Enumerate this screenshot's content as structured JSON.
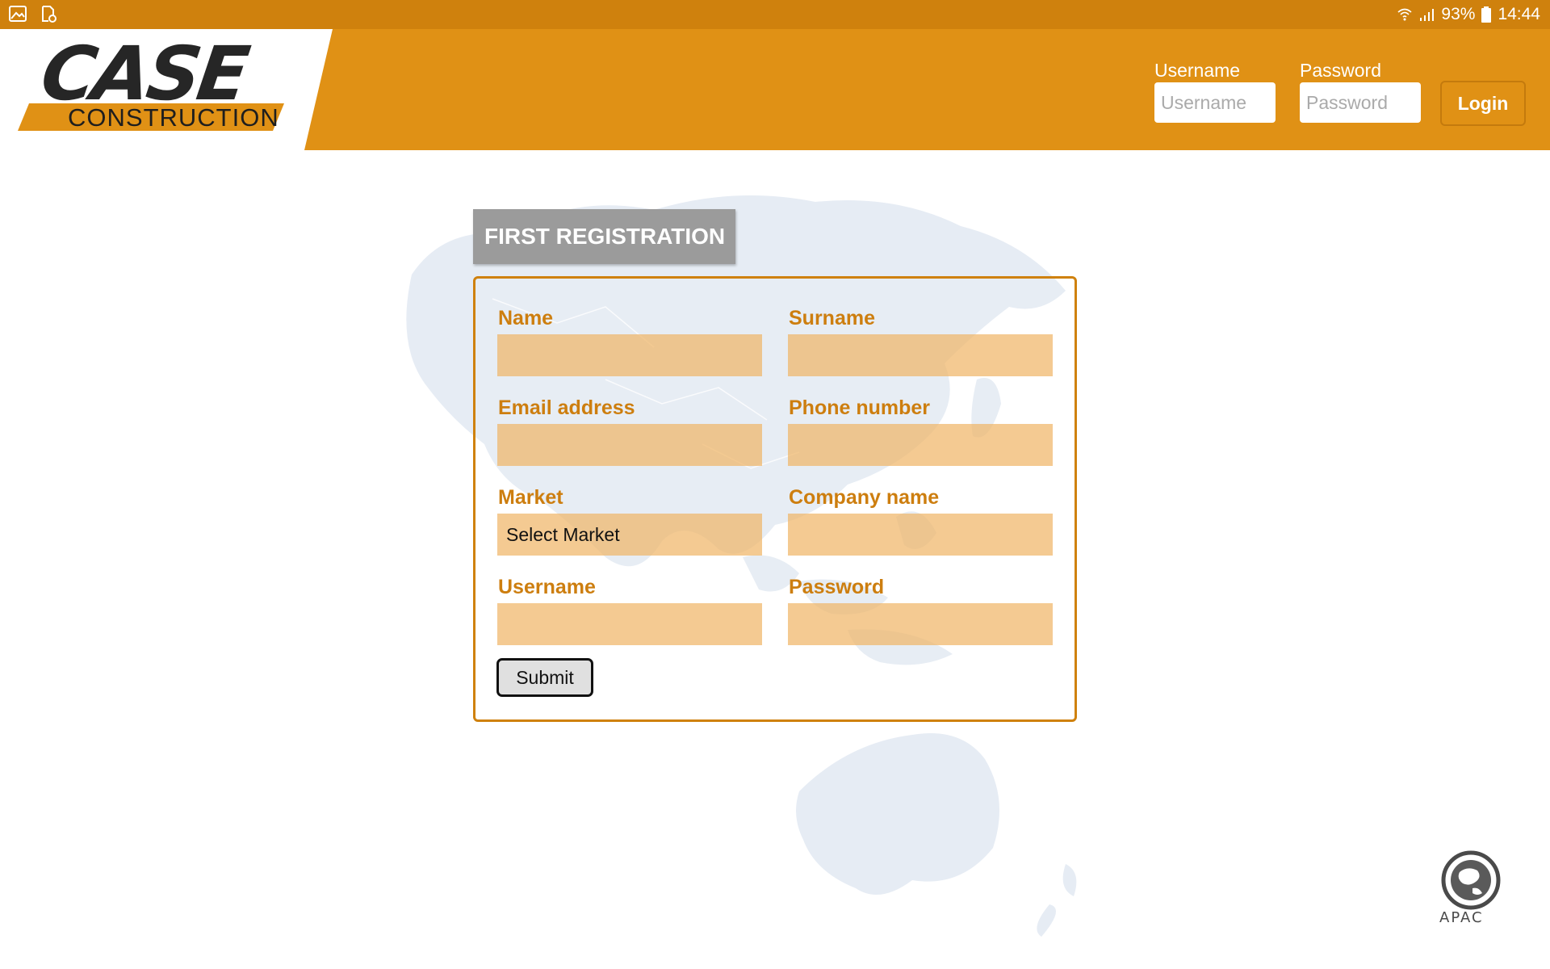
{
  "status_bar": {
    "left_icons": [
      "image-icon",
      "doc-settings-icon"
    ],
    "wifi_icon": "wifi-icon",
    "signal_icon": "signal-icon",
    "battery_percent": "93%",
    "battery_icon": "battery-icon",
    "time": "14:44"
  },
  "header": {
    "logo": {
      "brand": "CASE",
      "sub": "CONSTRUCTION"
    },
    "username_label": "Username",
    "username_placeholder": "Username",
    "password_label": "Password",
    "password_placeholder": "Password",
    "login_label": "Login"
  },
  "registration": {
    "title": "FIRST REGISTRATION",
    "fields": {
      "name_label": "Name",
      "surname_label": "Surname",
      "email_label": "Email address",
      "phone_label": "Phone number",
      "market_label": "Market",
      "market_selected": "Select Market",
      "company_label": "Company name",
      "username_label": "Username",
      "password_label": "Password"
    },
    "submit_label": "Submit"
  },
  "footer": {
    "apac_label": "APAC"
  },
  "colors": {
    "status_bar": "#cf810d",
    "header": "#e09115",
    "label": "#cd7e0f",
    "input_fill": "#f2c48c",
    "tab": "#9b9b9b"
  }
}
